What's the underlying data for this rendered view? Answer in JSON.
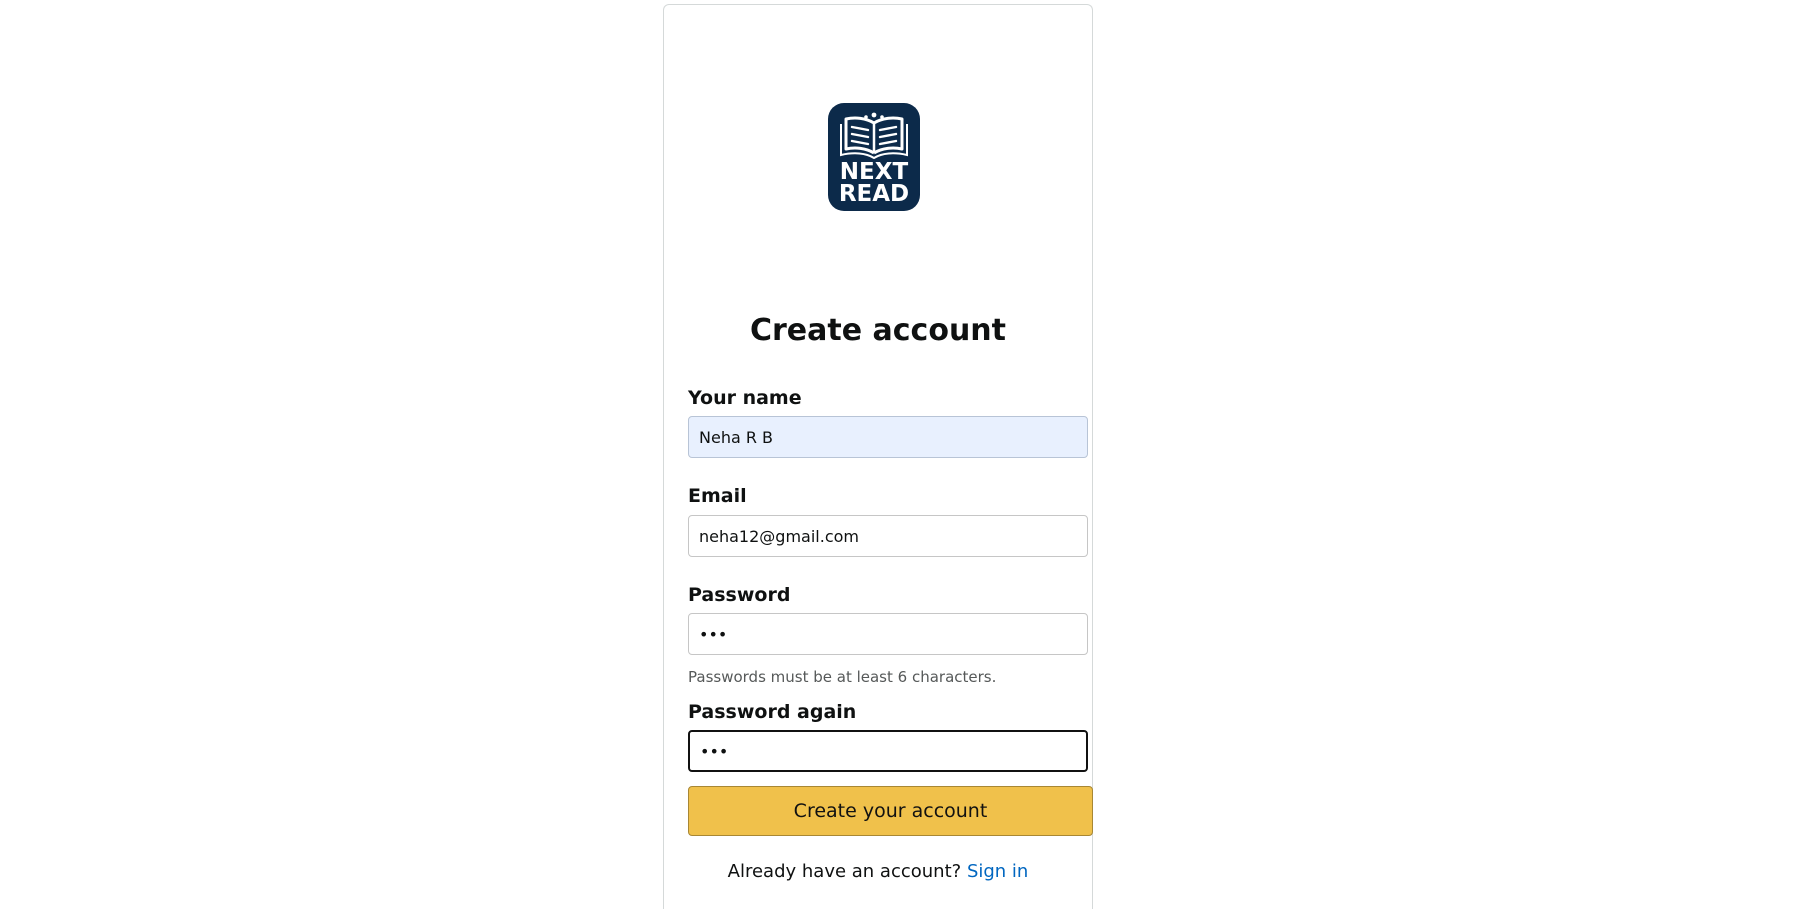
{
  "brand": {
    "logo_line1": "NEXT",
    "logo_line2": "READ",
    "logo_bg": "#0c2a4a"
  },
  "form": {
    "title": "Create account",
    "name": {
      "label": "Your name",
      "value": "Neha R B"
    },
    "email": {
      "label": "Email",
      "value": "neha12@gmail.com"
    },
    "password": {
      "label": "Password",
      "value": "•••",
      "hint": "Passwords must be at least 6 characters."
    },
    "password_again": {
      "label": "Password again",
      "value": "•••"
    },
    "submit_label": "Create your account",
    "submit_color": "#f0c14b"
  },
  "footer": {
    "prompt": "Already have an account?",
    "link_label": "Sign in",
    "link_color": "#0066c0"
  }
}
